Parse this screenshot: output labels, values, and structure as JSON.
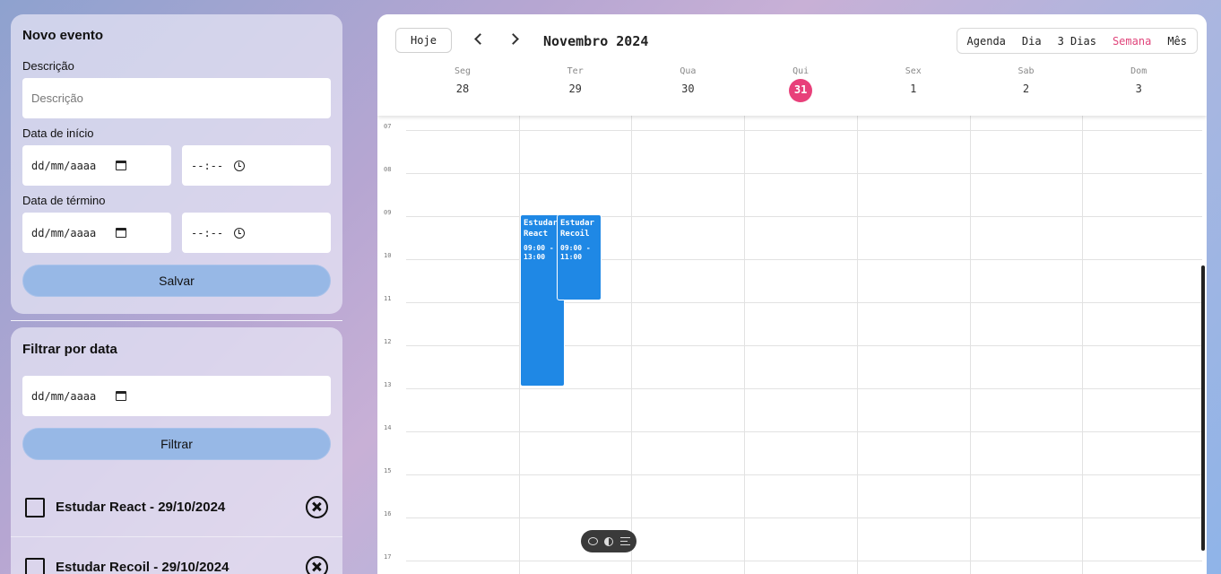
{
  "new_event": {
    "title": "Novo evento",
    "description_label": "Descrição",
    "description_placeholder": "Descrição",
    "start_label": "Data de início",
    "start_date": "dd/mm/aaaa",
    "start_time": "--:--",
    "end_label": "Data de término",
    "end_date": "dd/mm/aaaa",
    "end_time": "--:--",
    "save_label": "Salvar"
  },
  "filter": {
    "title": "Filtrar por data",
    "date": "dd/mm/aaaa",
    "filter_label": "Filtrar",
    "events": [
      {
        "label": "Estudar React - 29/10/2024",
        "checked": false
      },
      {
        "label": "Estudar Recoil - 29/10/2024",
        "checked": false
      }
    ]
  },
  "calendar": {
    "today_label": "Hoje",
    "month_title": "Novembro 2024",
    "views": [
      "Agenda",
      "Dia",
      "3 Dias",
      "Semana",
      "Mês"
    ],
    "active_view": "Semana",
    "days": [
      {
        "name": "Seg",
        "num": "28",
        "today": false
      },
      {
        "name": "Ter",
        "num": "29",
        "today": false
      },
      {
        "name": "Qua",
        "num": "30",
        "today": false
      },
      {
        "name": "Qui",
        "num": "31",
        "today": true
      },
      {
        "name": "Sex",
        "num": "1",
        "today": false
      },
      {
        "name": "Sab",
        "num": "2",
        "today": false
      },
      {
        "name": "Dom",
        "num": "3",
        "today": false
      }
    ],
    "hours": [
      "07",
      "08",
      "09",
      "10",
      "11",
      "12",
      "13",
      "14",
      "15",
      "16",
      "17"
    ],
    "events": [
      {
        "title": "Estudar\nReact",
        "time": "09:00 -\n13:00",
        "day": 1,
        "start": 9,
        "end": 13,
        "slot": 0
      },
      {
        "title": "Estudar\nRecoil",
        "time": "09:00 -\n11:00",
        "day": 1,
        "start": 9,
        "end": 11,
        "slot": 1
      }
    ],
    "accent_color": "#e8407a",
    "event_color": "#1f88e5"
  },
  "toolbar": {
    "icons": [
      "chat-icon",
      "contrast-icon",
      "list-icon"
    ]
  }
}
